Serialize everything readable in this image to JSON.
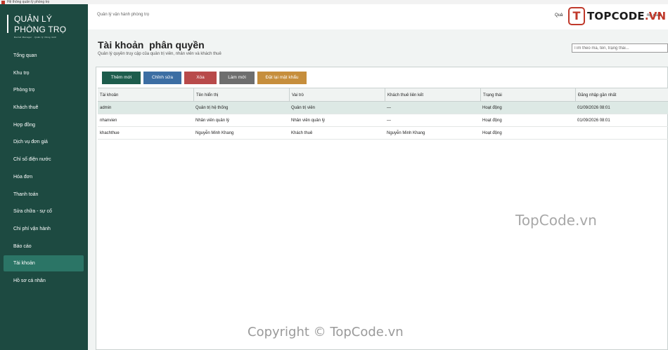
{
  "window": {
    "title": "Hệ thống quản lý phòng trọ"
  },
  "brand": {
    "title_line1": "QUẢN LÝ",
    "title_line2": "PHÒNG TRỌ",
    "subtitle": "Rental Manager · Quản lý thông minh"
  },
  "sidebar": {
    "items": [
      {
        "label": "Tổng quan"
      },
      {
        "label": "Khu trọ"
      },
      {
        "label": "Phòng trọ"
      },
      {
        "label": "Khách thuê"
      },
      {
        "label": "Hợp đồng"
      },
      {
        "label": "Dịch vụ  đơn giá"
      },
      {
        "label": "Chỉ số điện nước"
      },
      {
        "label": "Hóa đơn"
      },
      {
        "label": "Thanh toán"
      },
      {
        "label": "Sửa chữa - sự cố"
      },
      {
        "label": "Chi phí vận hành"
      },
      {
        "label": "Báo cáo"
      },
      {
        "label": "Tài khoản",
        "active": true
      },
      {
        "label": "Hồ sơ cá nhân"
      }
    ]
  },
  "topbar": {
    "context": "Quản lý vận hành phòng trọ",
    "user_label": "Quả",
    "logout_label": "ng xuất"
  },
  "page": {
    "title": "Tài khoản  phân quyền",
    "subtitle": "Quản lý quyền truy cập của quản trị viên, nhân viên và khách thuê",
    "search_placeholder": "Tìm theo mã, tên, trạng thái..."
  },
  "toolbar": {
    "add_label": "Thêm mới",
    "edit_label": "Chỉnh sửa",
    "delete_label": "Xóa",
    "refresh_label": "Làm mới",
    "reset_password_label": "Đặt lại mật khẩu"
  },
  "table": {
    "columns": [
      "Tài khoản",
      "Tên hiển thị",
      "Vai trò",
      "Khách thuê liên kết",
      "Trạng thái",
      "Đăng nhập gần nhất"
    ],
    "rows": [
      [
        "admin",
        "Quản trị hệ thống",
        "Quản trị viên",
        "—",
        "Hoạt động",
        "01/09/2026 08:01"
      ],
      [
        "nhanvien",
        "Nhân viên quản lý",
        "Nhân viên quản lý",
        "—",
        "Hoạt động",
        "01/09/2026 08:01"
      ],
      [
        "khachthue",
        "Nguyễn Minh Khang",
        "Khách thuê",
        "Nguyễn Minh Khang",
        "Hoạt động",
        ""
      ]
    ],
    "selected_row": 0
  },
  "watermarks": {
    "logo_text": "TOPCODE",
    "logo_suffix": ".VN",
    "logo_mark": "T",
    "middle": "TopCode.vn",
    "copyright": "Copyright © TopCode.vn"
  },
  "colors": {
    "sidebar_bg": "#1d4a41",
    "sidebar_active": "#2b7566",
    "btn_add": "#1d5c4c",
    "btn_edit": "#3c6ea3",
    "btn_delete": "#b84a4a",
    "btn_refresh": "#6e6e6e",
    "btn_reset": "#c68e3c",
    "selected_row": "#dde9e5"
  }
}
